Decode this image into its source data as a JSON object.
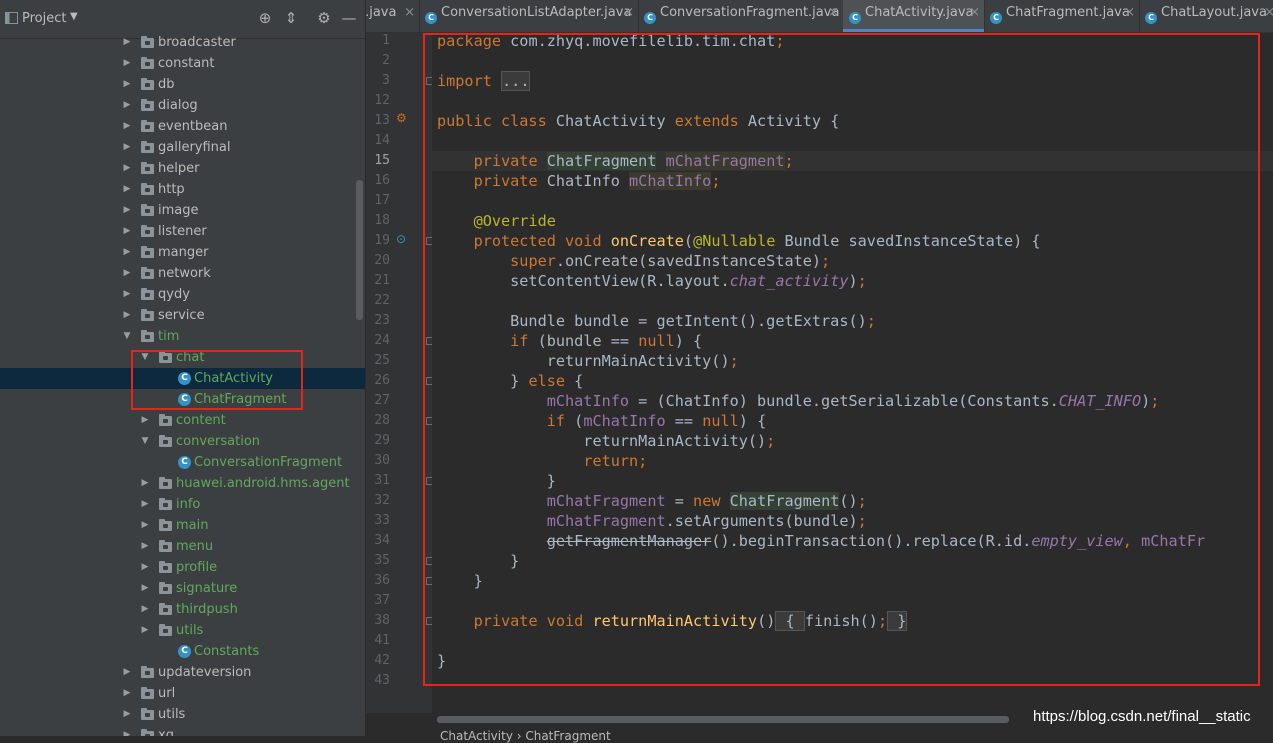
{
  "project_panel": {
    "title": "Project",
    "tree": [
      {
        "label": "broadcaster",
        "depth": 0,
        "kind": "folder",
        "expanded": false,
        "color": "default"
      },
      {
        "label": "constant",
        "depth": 0,
        "kind": "folder",
        "expanded": false,
        "color": "default"
      },
      {
        "label": "db",
        "depth": 0,
        "kind": "folder",
        "expanded": false,
        "color": "default"
      },
      {
        "label": "dialog",
        "depth": 0,
        "kind": "folder",
        "expanded": false,
        "color": "default"
      },
      {
        "label": "eventbean",
        "depth": 0,
        "kind": "folder",
        "expanded": false,
        "color": "default"
      },
      {
        "label": "galleryfinal",
        "depth": 0,
        "kind": "folder",
        "expanded": false,
        "color": "default"
      },
      {
        "label": "helper",
        "depth": 0,
        "kind": "folder",
        "expanded": false,
        "color": "default"
      },
      {
        "label": "http",
        "depth": 0,
        "kind": "folder",
        "expanded": false,
        "color": "default"
      },
      {
        "label": "image",
        "depth": 0,
        "kind": "folder",
        "expanded": false,
        "color": "default"
      },
      {
        "label": "listener",
        "depth": 0,
        "kind": "folder",
        "expanded": false,
        "color": "default"
      },
      {
        "label": "manger",
        "depth": 0,
        "kind": "folder",
        "expanded": false,
        "color": "default"
      },
      {
        "label": "network",
        "depth": 0,
        "kind": "folder",
        "expanded": false,
        "color": "default"
      },
      {
        "label": "qydy",
        "depth": 0,
        "kind": "folder",
        "expanded": false,
        "color": "default"
      },
      {
        "label": "service",
        "depth": 0,
        "kind": "folder",
        "expanded": false,
        "color": "default"
      },
      {
        "label": "tim",
        "depth": 0,
        "kind": "folder",
        "expanded": true,
        "color": "green"
      },
      {
        "label": "chat",
        "depth": 1,
        "kind": "folder",
        "expanded": true,
        "color": "green"
      },
      {
        "label": "ChatActivity",
        "depth": 2,
        "kind": "class",
        "expanded": false,
        "color": "green",
        "selected": true
      },
      {
        "label": "ChatFragment",
        "depth": 2,
        "kind": "class",
        "expanded": false,
        "color": "green"
      },
      {
        "label": "content",
        "depth": 1,
        "kind": "folder",
        "expanded": false,
        "color": "green"
      },
      {
        "label": "conversation",
        "depth": 1,
        "kind": "folder",
        "expanded": true,
        "color": "green"
      },
      {
        "label": "ConversationFragment",
        "depth": 2,
        "kind": "class",
        "expanded": false,
        "color": "green"
      },
      {
        "label": "huawei.android.hms.agent",
        "depth": 1,
        "kind": "folder",
        "expanded": false,
        "color": "green"
      },
      {
        "label": "info",
        "depth": 1,
        "kind": "folder",
        "expanded": false,
        "color": "green"
      },
      {
        "label": "main",
        "depth": 1,
        "kind": "folder",
        "expanded": false,
        "color": "green"
      },
      {
        "label": "menu",
        "depth": 1,
        "kind": "folder",
        "expanded": false,
        "color": "green"
      },
      {
        "label": "profile",
        "depth": 1,
        "kind": "folder",
        "expanded": false,
        "color": "green"
      },
      {
        "label": "signature",
        "depth": 1,
        "kind": "folder",
        "expanded": false,
        "color": "green"
      },
      {
        "label": "thirdpush",
        "depth": 1,
        "kind": "folder",
        "expanded": false,
        "color": "green"
      },
      {
        "label": "utils",
        "depth": 1,
        "kind": "folder",
        "expanded": false,
        "color": "green"
      },
      {
        "label": "Constants",
        "depth": 1,
        "kind": "class",
        "expanded": false,
        "color": "green",
        "leaf": true
      },
      {
        "label": "updateversion",
        "depth": 0,
        "kind": "folder",
        "expanded": false,
        "color": "default"
      },
      {
        "label": "url",
        "depth": 0,
        "kind": "folder",
        "expanded": false,
        "color": "default"
      },
      {
        "label": "utils",
        "depth": 0,
        "kind": "folder",
        "expanded": false,
        "color": "default"
      },
      {
        "label": "xg",
        "depth": 0,
        "kind": "folder",
        "expanded": false,
        "color": "default"
      }
    ]
  },
  "tabs": [
    {
      "label": "t.java",
      "active": false,
      "icon": false
    },
    {
      "label": "ConversationListAdapter.java",
      "active": false,
      "icon": true
    },
    {
      "label": "ConversationFragment.java",
      "active": false,
      "icon": true
    },
    {
      "label": "ChatActivity.java",
      "active": true,
      "icon": true
    },
    {
      "label": "ChatFragment.java",
      "active": false,
      "icon": true
    },
    {
      "label": "ChatLayout.java",
      "active": false,
      "icon": true
    }
  ],
  "editor": {
    "current_line": "15",
    "lines": [
      {
        "n": "1",
        "html": "<span class=\"kw\">package</span> com.zhyq.movefilelib.tim.chat<span class=\"kw\">;</span>"
      },
      {
        "n": "2",
        "html": ""
      },
      {
        "n": "3",
        "html": "<span class=\"kw\">import</span> <span class=\"hl-fold\">...</span>"
      },
      {
        "n": "12",
        "html": ""
      },
      {
        "n": "13",
        "html": "<span class=\"kw\">public class</span> ChatActivity <span class=\"kw\">extends</span> Activity {"
      },
      {
        "n": "14",
        "html": ""
      },
      {
        "n": "15",
        "html": "    <span class=\"kw\">private</span> <span class=\"hl-green\">ChatFragment</span> <span class=\"fld\" style=\"background:#3b3a2e\">mChatFragment</span><span class=\"kw\">;</span>"
      },
      {
        "n": "16",
        "html": "    <span class=\"kw\">private</span> ChatInfo <span class=\"fld\" style=\"background:#3b3a2e\">mChatInfo</span><span class=\"kw\">;</span>"
      },
      {
        "n": "17",
        "html": ""
      },
      {
        "n": "18",
        "html": "    <span class=\"ann\">@Override</span>"
      },
      {
        "n": "19",
        "html": "    <span class=\"kw\">protected void</span> <span class=\"fn\">onCreate</span>(<span class=\"ann\">@Nullable</span> Bundle savedInstanceState) {"
      },
      {
        "n": "20",
        "html": "        <span class=\"kw\">super</span>.onCreate(savedInstanceState)<span class=\"kw\">;</span>"
      },
      {
        "n": "21",
        "html": "        setContentView(R.layout.<span class=\"ital\">chat_activity</span>)<span class=\"kw\">;</span>"
      },
      {
        "n": "22",
        "html": ""
      },
      {
        "n": "23",
        "html": "        Bundle bundle = getIntent().getExtras()<span class=\"kw\">;</span>"
      },
      {
        "n": "24",
        "html": "        <span class=\"kw\">if</span> (bundle == <span class=\"kw\">null</span>) {"
      },
      {
        "n": "25",
        "html": "            returnMainActivity()<span class=\"kw\">;</span>"
      },
      {
        "n": "26",
        "html": "        } <span class=\"kw\">else</span> {"
      },
      {
        "n": "27",
        "html": "            <span class=\"fld\">mChatInfo</span> = (ChatInfo) bundle.getSerializable(Constants.<span class=\"ital\">CHAT_INFO</span>)<span class=\"kw\">;</span>"
      },
      {
        "n": "28",
        "html": "            <span class=\"kw\">if</span> (<span class=\"fld\">mChatInfo</span> == <span class=\"kw\">null</span>) {"
      },
      {
        "n": "29",
        "html": "                returnMainActivity()<span class=\"kw\">;</span>"
      },
      {
        "n": "30",
        "html": "                <span class=\"kw\">return;</span>"
      },
      {
        "n": "31",
        "html": "            }"
      },
      {
        "n": "32",
        "html": "            <span class=\"fld\">mChatFragment</span> = <span class=\"kw\">new</span> <span class=\"hl-green\">ChatFragment</span>()<span class=\"kw\">;</span>"
      },
      {
        "n": "33",
        "html": "            <span class=\"fld\">mChatFragment</span>.setArguments(bundle)<span class=\"kw\">;</span>"
      },
      {
        "n": "34",
        "html": "            <span class=\"strike\">getFragmentManager</span>().beginTransaction().replace(R.id.<span class=\"ital\">empty_view</span><span class=\"kw\">,</span> <span class=\"fld\">mChatFr</span>"
      },
      {
        "n": "35",
        "html": "        }"
      },
      {
        "n": "36",
        "html": "    }"
      },
      {
        "n": "37",
        "html": ""
      },
      {
        "n": "38",
        "html": "    <span class=\"kw\">private void</span> <span class=\"fn\">returnMainActivity</span>()<span class=\"hl-fold\"> { </span>finish()<span class=\"kw\">;</span><span class=\"hl-fold\"> }</span>"
      },
      {
        "n": "41",
        "html": ""
      },
      {
        "n": "42",
        "html": "}"
      },
      {
        "n": "43",
        "html": ""
      }
    ]
  },
  "watermark": "https://blog.csdn.net/final__static",
  "breadcrumbs": "ChatActivity  ›  ChatFragment",
  "colors": {
    "highlight_box": "#e5241c",
    "keyword": "#cc7832",
    "field": "#9876aa",
    "annotation": "#bbb529",
    "method": "#ffc66d",
    "green_label": "#62a85c"
  }
}
